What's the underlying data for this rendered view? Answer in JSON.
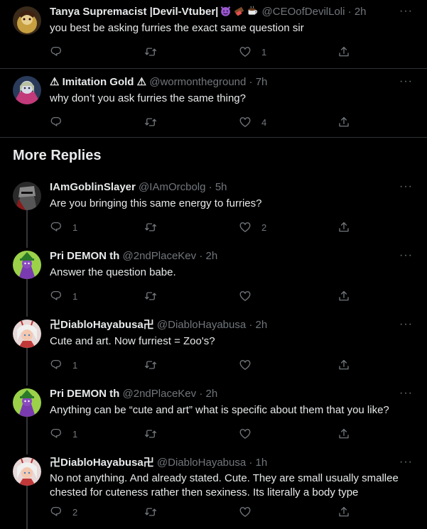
{
  "tweets_top": [
    {
      "name": "Tanya Supremacist |Devil-Vtuber|",
      "handle": "@CEOofDevilLoli",
      "time": "2h",
      "text": "you best be asking furries the exact same question sir",
      "replies": "",
      "reposts": "",
      "likes": "1"
    },
    {
      "name": "⚠ Imitation Gold ⚠",
      "handle": "@wormontheground",
      "time": "7h",
      "text": "why don’t you ask furries the same thing?",
      "replies": "",
      "reposts": "",
      "likes": "4"
    }
  ],
  "section": {
    "title": "More Replies"
  },
  "replies": [
    {
      "name": "IAmGoblinSlayer",
      "handle": "@IAmOrcbolg",
      "time": "5h",
      "text": "Are you bringing this same energy to furries?",
      "replies": "1",
      "likes": "2"
    },
    {
      "name": "Pri DEMON th",
      "handle": "@2ndPlaceKev",
      "time": "2h",
      "text": "Answer the question babe.",
      "replies": "1",
      "likes": ""
    },
    {
      "name": "卍DiabloHayabusa卍",
      "handle": "@DiabloHayabusa",
      "time": "2h",
      "text": "Cute and art. Now furriest = Zoo's?",
      "replies": "1",
      "likes": ""
    },
    {
      "name": "Pri DEMON th",
      "handle": "@2ndPlaceKev",
      "time": "2h",
      "text": "Anything can be “cute and art” what is specific about them that you like?",
      "replies": "1",
      "likes": ""
    },
    {
      "name": "卍DiabloHayabusa卍",
      "handle": "@DiabloHayabusa",
      "time": "1h",
      "text": "No not anything. And already stated. Cute. They are small usually smallee chested for cuteness rather then sexiness. Its literally a body type",
      "replies": "2",
      "likes": ""
    }
  ],
  "ui": {
    "dot": "·",
    "more": "···"
  },
  "colors": {
    "bg": "#000000",
    "text": "#e7e9ea",
    "muted": "#71767b",
    "border": "#2f3336"
  }
}
